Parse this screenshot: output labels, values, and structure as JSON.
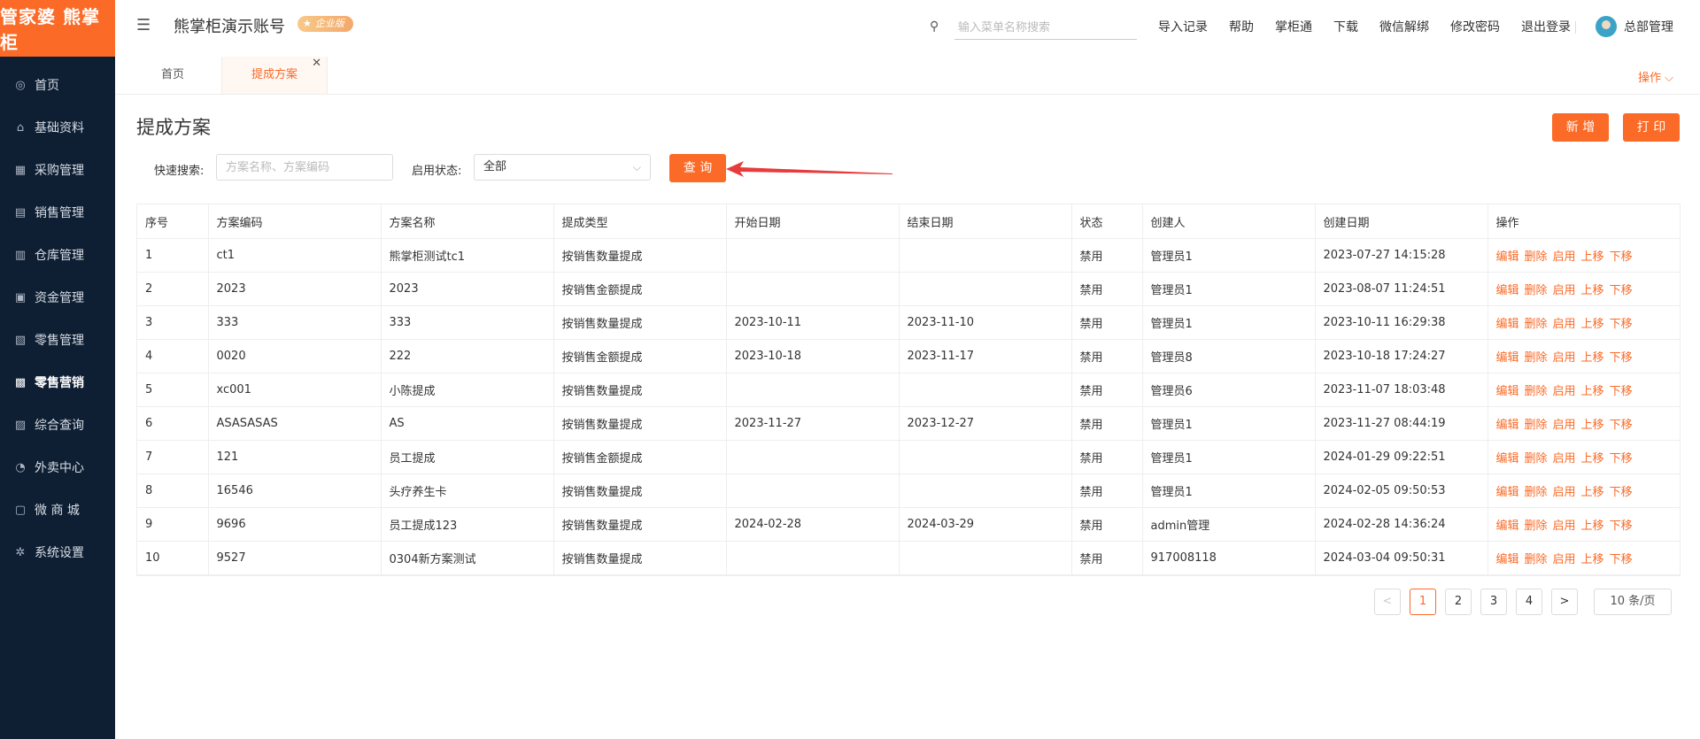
{
  "brand": {
    "logo_text": "管家婆 熊掌柜",
    "accent": "#fb6a26",
    "sidebar_bg": "#0f1f33"
  },
  "sidebar": {
    "items": [
      {
        "label": "首页",
        "icon": "globe-icon",
        "glyph": "◎"
      },
      {
        "label": "基础资料",
        "icon": "home-icon",
        "glyph": "⌂"
      },
      {
        "label": "采购管理",
        "icon": "cart-icon",
        "glyph": "▦"
      },
      {
        "label": "销售管理",
        "icon": "receipt-icon",
        "glyph": "▤"
      },
      {
        "label": "仓库管理",
        "icon": "warehouse-icon",
        "glyph": "▥"
      },
      {
        "label": "资金管理",
        "icon": "money-icon",
        "glyph": "▣"
      },
      {
        "label": "零售管理",
        "icon": "chart-icon",
        "glyph": "▧"
      },
      {
        "label": "零售营销",
        "icon": "gift-icon",
        "glyph": "▩"
      },
      {
        "label": "综合查询",
        "icon": "bar-chart-icon",
        "glyph": "▨"
      },
      {
        "label": "外卖中心",
        "icon": "bell-icon",
        "glyph": "◔"
      },
      {
        "label": "微 商 城",
        "icon": "shop-bag-icon",
        "glyph": "▢"
      },
      {
        "label": "系统设置",
        "icon": "gear-icon",
        "glyph": "✲"
      }
    ],
    "active_index": 7
  },
  "header": {
    "account_name": "熊掌柜演示账号",
    "edition_badge": "企业版",
    "search_placeholder": "输入菜单名称搜索",
    "links": [
      "导入记录",
      "帮助",
      "掌柜通",
      "下载",
      "微信解绑",
      "修改密码",
      "退出登录"
    ],
    "user_name": "总部管理"
  },
  "tabs": {
    "home": "首页",
    "active": "提成方案",
    "ops_label": "操作"
  },
  "page": {
    "title": "提成方案",
    "add_label": "新 增",
    "print_label": "打 印",
    "quick_search_label": "快速搜索:",
    "quick_search_placeholder": "方案名称、方案编码",
    "status_label": "启用状态:",
    "status_value": "全部",
    "query_label": "查 询"
  },
  "table": {
    "headers": [
      "序号",
      "方案编码",
      "方案名称",
      "提成类型",
      "开始日期",
      "结束日期",
      "状态",
      "创建人",
      "创建日期",
      "操作"
    ],
    "actions": [
      "编辑",
      "删除",
      "启用",
      "上移",
      "下移"
    ],
    "rows": [
      [
        "1",
        "ct1",
        "熊掌柜测试tc1",
        "按销售数量提成",
        "",
        "",
        "禁用",
        "管理员1",
        "2023-07-27 14:15:28"
      ],
      [
        "2",
        "2023",
        "2023",
        "按销售金额提成",
        "",
        "",
        "禁用",
        "管理员1",
        "2023-08-07 11:24:51"
      ],
      [
        "3",
        "333",
        "333",
        "按销售数量提成",
        "2023-10-11",
        "2023-11-10",
        "禁用",
        "管理员1",
        "2023-10-11 16:29:38"
      ],
      [
        "4",
        "0020",
        "222",
        "按销售金额提成",
        "2023-10-18",
        "2023-11-17",
        "禁用",
        "管理员8",
        "2023-10-18 17:24:27"
      ],
      [
        "5",
        "xc001",
        "小陈提成",
        "按销售数量提成",
        "",
        "",
        "禁用",
        "管理员6",
        "2023-11-07 18:03:48"
      ],
      [
        "6",
        "ASASASAS",
        "AS",
        "按销售数量提成",
        "2023-11-27",
        "2023-12-27",
        "禁用",
        "管理员1",
        "2023-11-27 08:44:19"
      ],
      [
        "7",
        "121",
        "员工提成",
        "按销售金额提成",
        "",
        "",
        "禁用",
        "管理员1",
        "2024-01-29 09:22:51"
      ],
      [
        "8",
        "16546",
        "头疗养生卡",
        "按销售数量提成",
        "",
        "",
        "禁用",
        "管理员1",
        "2024-02-05 09:50:53"
      ],
      [
        "9",
        "9696",
        "员工提成123",
        "按销售数量提成",
        "2024-02-28",
        "2024-03-29",
        "禁用",
        "admin管理",
        "2024-02-28 14:36:24"
      ],
      [
        "10",
        "9527",
        "0304新方案测试",
        "按销售数量提成",
        "",
        "",
        "禁用",
        "917008118",
        "2024-03-04 09:50:31"
      ]
    ]
  },
  "pagination": {
    "prev": "<",
    "next": ">",
    "pages": [
      "1",
      "2",
      "3",
      "4"
    ],
    "current": "1",
    "page_size": "10 条/页"
  }
}
